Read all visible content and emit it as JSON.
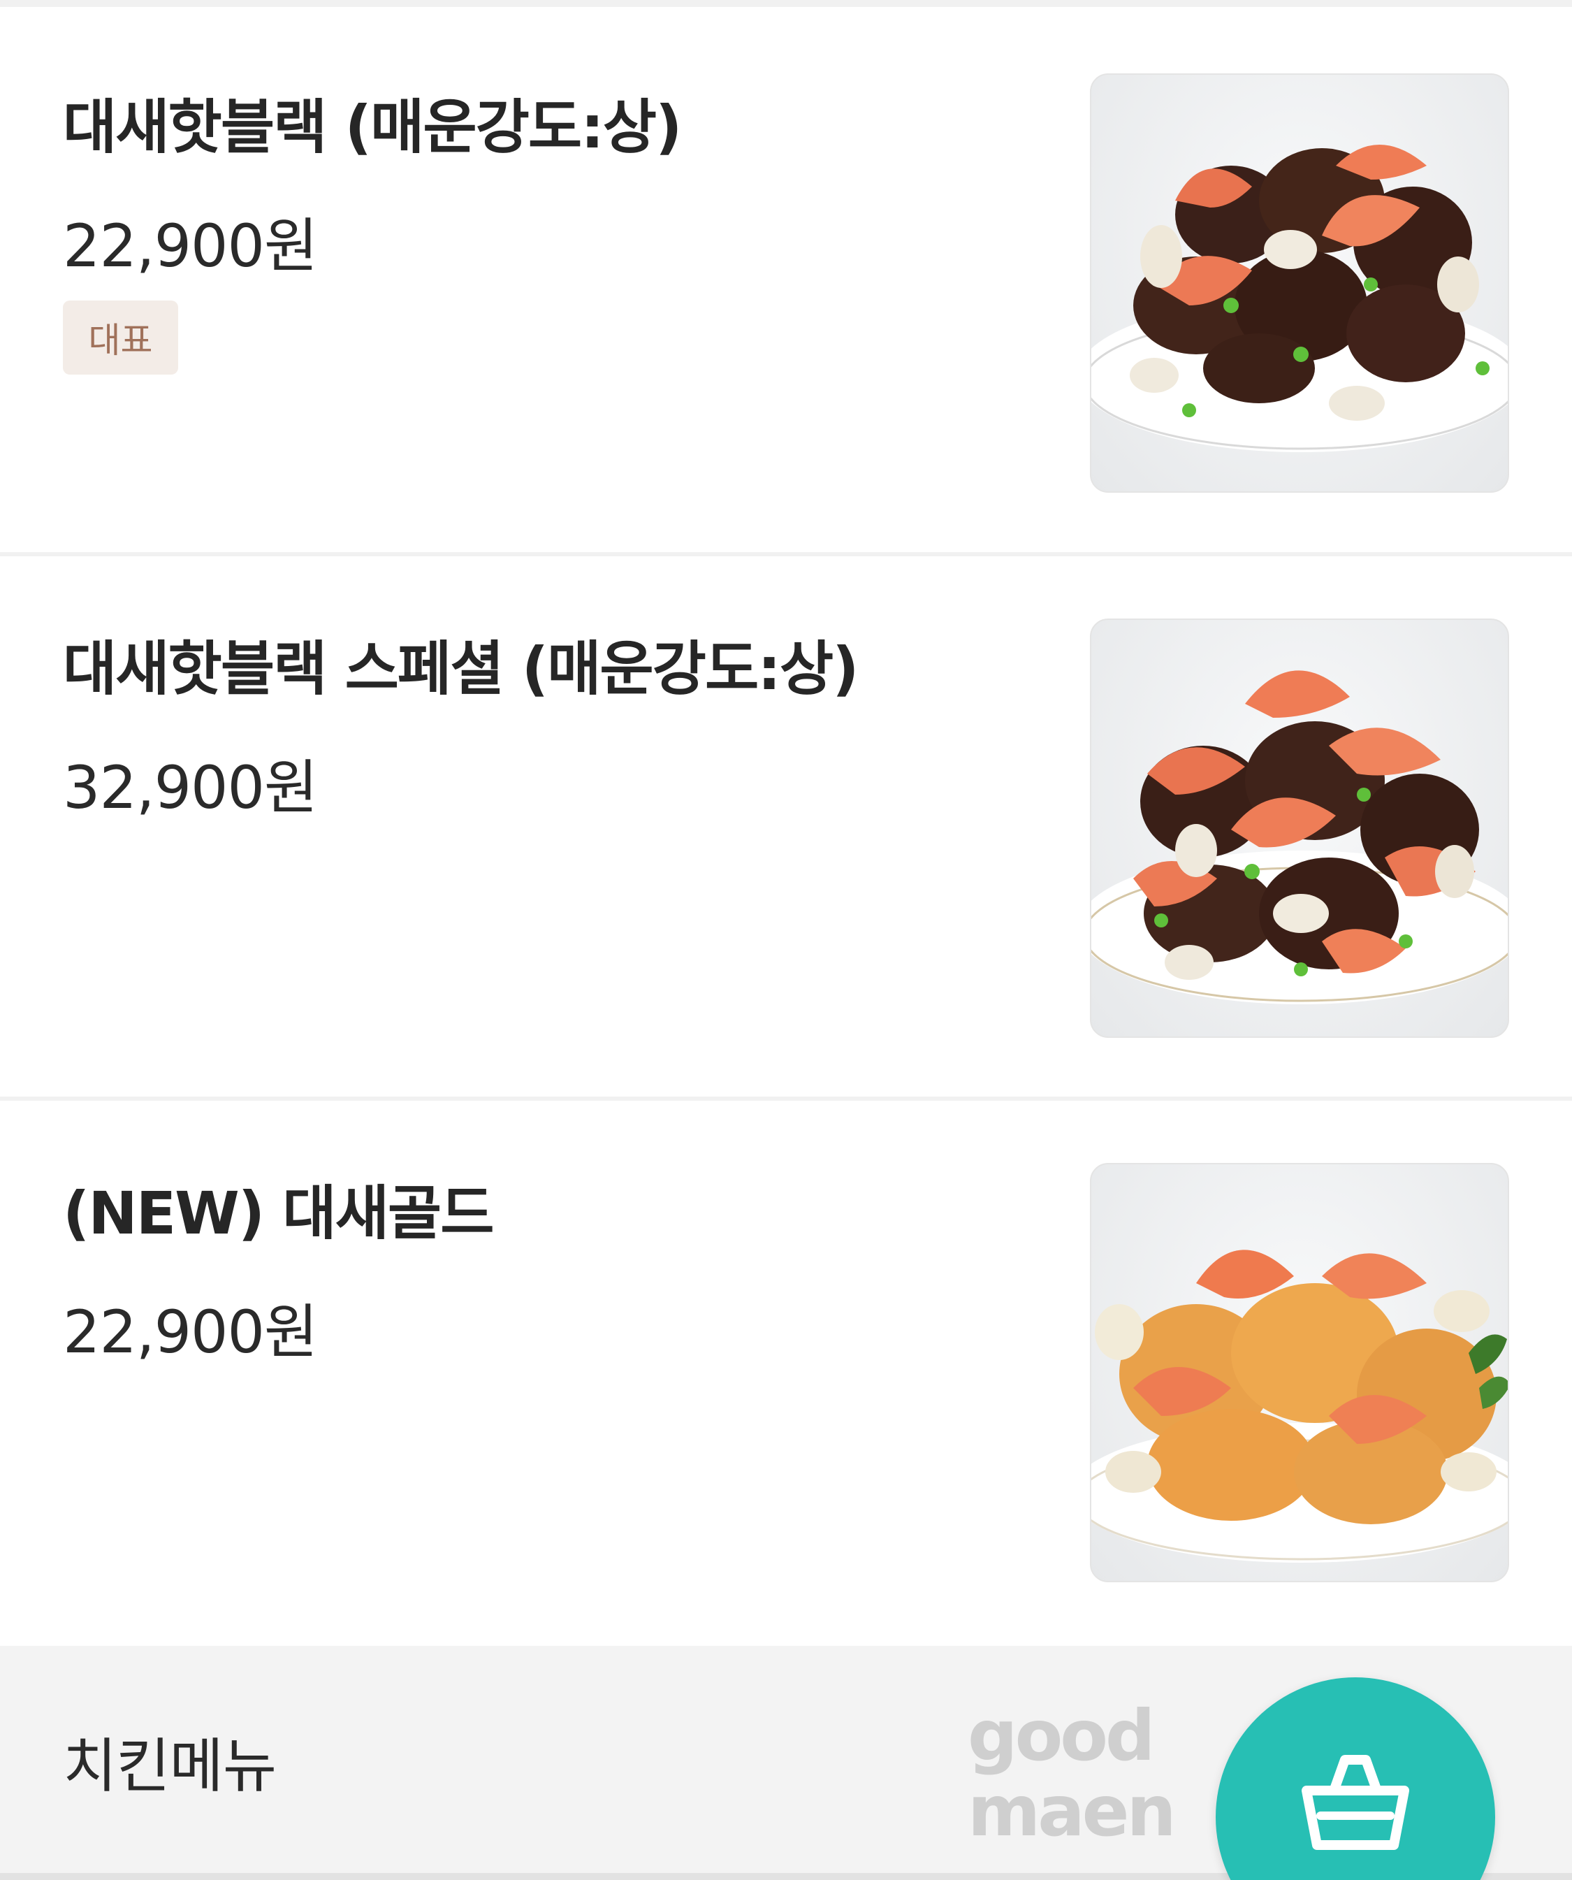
{
  "menu": {
    "items": [
      {
        "name": "대새핫블랙 (매운강도:상)",
        "price": "22,900원",
        "badge": "대표"
      },
      {
        "name": "대새핫블랙 스페셜 (매운강도:상)",
        "price": "32,900원"
      },
      {
        "name": "(NEW) 대새골드",
        "price": "22,900원"
      }
    ]
  },
  "bottom_bar": {
    "category_label": "치킨메뉴",
    "watermark": [
      "good",
      "maen"
    ]
  },
  "icons": {
    "thumbnail_1": "black-sauce-chicken-with-shrimp-photo",
    "thumbnail_2": "black-sauce-chicken-with-many-shrimp-photo",
    "thumbnail_3": "golden-fried-chicken-with-shrimp-photo",
    "cart": "shopping-basket-icon"
  },
  "colors": {
    "accent": "#27bfb4",
    "badge_bg": "#f3ece7",
    "badge_text": "#a0715a"
  }
}
